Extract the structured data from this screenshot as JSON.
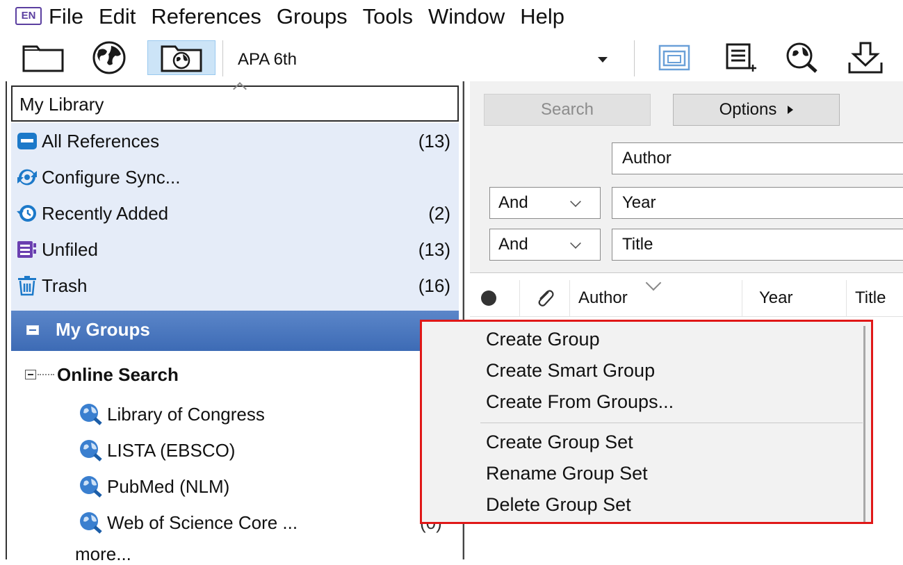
{
  "app": {
    "logo_text": "EN",
    "menu": [
      "File",
      "Edit",
      "References",
      "Groups",
      "Tools",
      "Window",
      "Help"
    ]
  },
  "toolbar": {
    "buttons": [
      "folder-icon",
      "globe-icon",
      "online-library-icon"
    ],
    "right_buttons": [
      "copy-library-icon",
      "new-reference-icon",
      "online-search-icon",
      "import-icon"
    ],
    "style_name": "APA 6th"
  },
  "library": {
    "title": "My Library",
    "items": [
      {
        "label": "All References",
        "count": "(13)",
        "icon": "all-references-icon"
      },
      {
        "label": "Configure Sync...",
        "count": "",
        "icon": "sync-icon"
      },
      {
        "label": "Recently Added",
        "count": "(2)",
        "icon": "recent-icon"
      },
      {
        "label": "Unfiled",
        "count": "(13)",
        "icon": "unfiled-icon"
      },
      {
        "label": "Trash",
        "count": "(16)",
        "icon": "trash-icon"
      }
    ],
    "my_groups": "My Groups",
    "online_search": "Online Search",
    "online_items": [
      {
        "label": "Library of Congress",
        "count": ""
      },
      {
        "label": "LISTA (EBSCO)",
        "count": ""
      },
      {
        "label": "PubMed (NLM)",
        "count": ""
      },
      {
        "label": "Web of Science Core ...",
        "count": "(0)"
      }
    ],
    "more": "more..."
  },
  "search": {
    "search_label": "Search",
    "options_label": "Options",
    "fields": [
      {
        "bool": "",
        "field": "Author"
      },
      {
        "bool": "And",
        "field": "Year"
      },
      {
        "bool": "And",
        "field": "Title"
      }
    ]
  },
  "table": {
    "columns": [
      "Author",
      "Year",
      "Title"
    ]
  },
  "context_menu": {
    "items": [
      "Create Group",
      "Create Smart Group",
      "Create From Groups...",
      "Create Group Set",
      "Rename Group Set",
      "Delete Group Set"
    ]
  },
  "colors": {
    "accent": "#3d6bb5",
    "highlight_border": "#e01818",
    "library_bg": "#e5ecf8"
  }
}
